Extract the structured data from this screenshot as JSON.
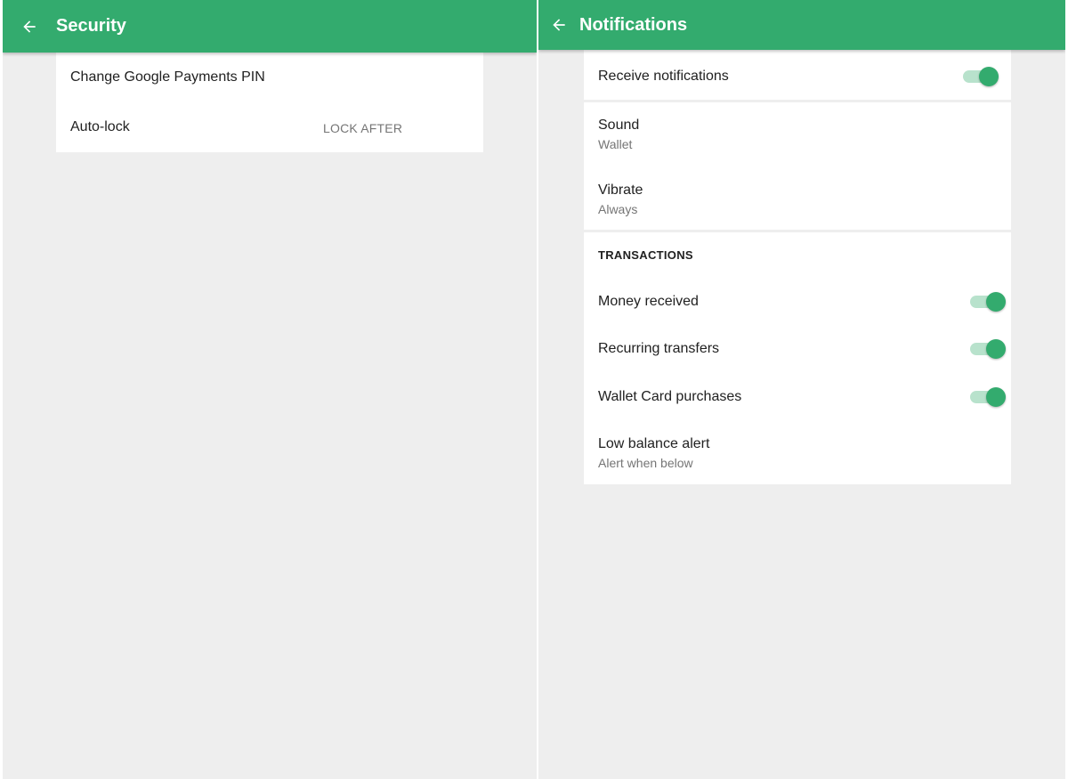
{
  "colors": {
    "accent": "#33ab6e",
    "track": "#b8e2cc",
    "background": "#eeeeee"
  },
  "security": {
    "title": "Security",
    "back_icon": "arrow-left-icon",
    "items": [
      {
        "label": "Change Google Payments PIN"
      },
      {
        "label": "Auto-lock",
        "value": "LOCK AFTER"
      }
    ]
  },
  "notifications": {
    "title": "Notifications",
    "back_icon": "arrow-left-icon",
    "receive": {
      "label": "Receive notifications",
      "enabled": true
    },
    "sound": {
      "label": "Sound",
      "value": "Wallet"
    },
    "vibrate": {
      "label": "Vibrate",
      "value": "Always"
    },
    "transactions": {
      "header": "TRANSACTIONS",
      "items": [
        {
          "label": "Money received",
          "enabled": true
        },
        {
          "label": "Recurring transfers",
          "enabled": true
        },
        {
          "label": "Wallet Card purchases",
          "enabled": true
        }
      ],
      "low_balance": {
        "label": "Low balance alert",
        "value": "Alert when below"
      }
    }
  }
}
